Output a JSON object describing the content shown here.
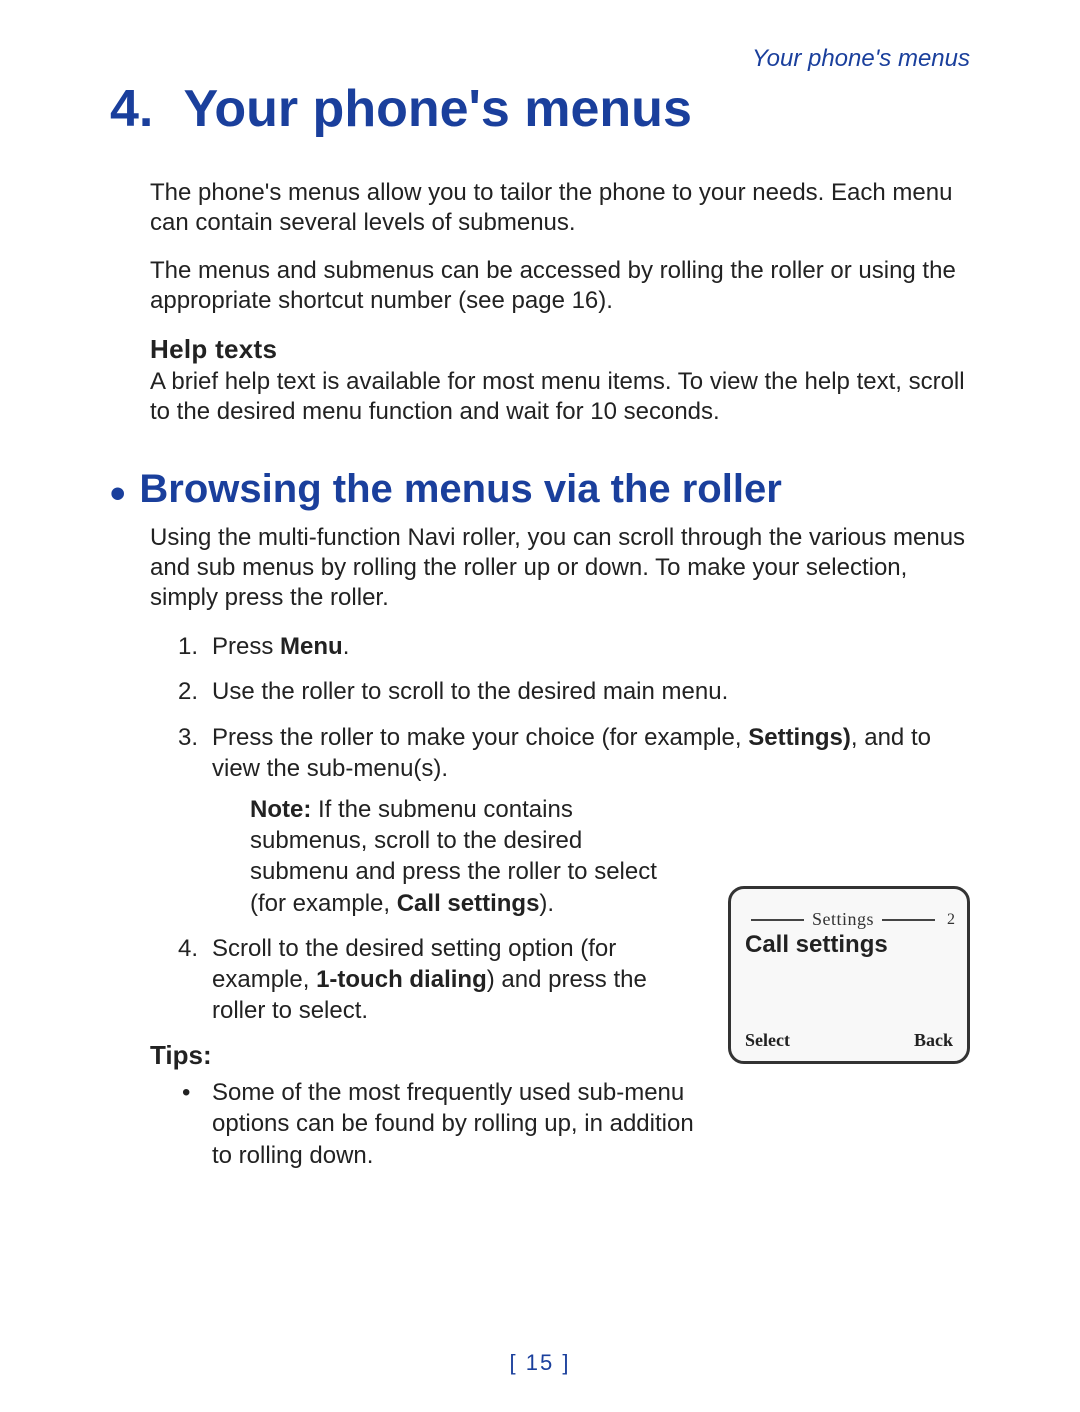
{
  "running_head": "Your phone's menus",
  "chapter": {
    "number": "4.",
    "title": "Your phone's menus"
  },
  "intro_p1": "The phone's menus allow you to tailor the phone to your needs. Each menu can contain several levels of submenus.",
  "intro_p2": "The menus and submenus can be accessed by rolling the roller or using the appropriate shortcut number (see page 16).",
  "help_head": "Help texts",
  "help_body": "A brief help text is available for most menu items. To view the help text, scroll to the desired menu function and wait for 10 seconds.",
  "section_browse": "Browsing the menus via the roller",
  "browse_intro": "Using the multi-function Navi roller, you can scroll through the various menus and sub menus by rolling the roller up or down. To make your selection, simply press the roller.",
  "steps": {
    "s1_pre": "Press ",
    "s1_bold": "Menu",
    "s1_post": ".",
    "s2": "Use the roller to scroll to the desired main menu.",
    "s3_pre": "Press the roller to make your choice (for example, ",
    "s3_bold": "Settings)",
    "s3_post": ", and to view the sub-menu(s).",
    "note_label": "Note:",
    "note_body_pre": " If the submenu contains submenus, scroll to the desired submenu and press the roller to select (for example, ",
    "note_bold": "Call settings",
    "note_body_post": ").",
    "s4_pre": "Scroll to the desired setting option (for example, ",
    "s4_bold": "1-touch dialing",
    "s4_post": ") and press the roller to select."
  },
  "figure": {
    "header": "Settings",
    "index": "2",
    "item": "Call settings",
    "softkey_left": "Select",
    "softkey_right": "Back"
  },
  "tips_head": "Tips:",
  "tip1": "Some of the most frequently used sub-menu options can be found by rolling up, in addition to rolling down.",
  "page_number": "15"
}
